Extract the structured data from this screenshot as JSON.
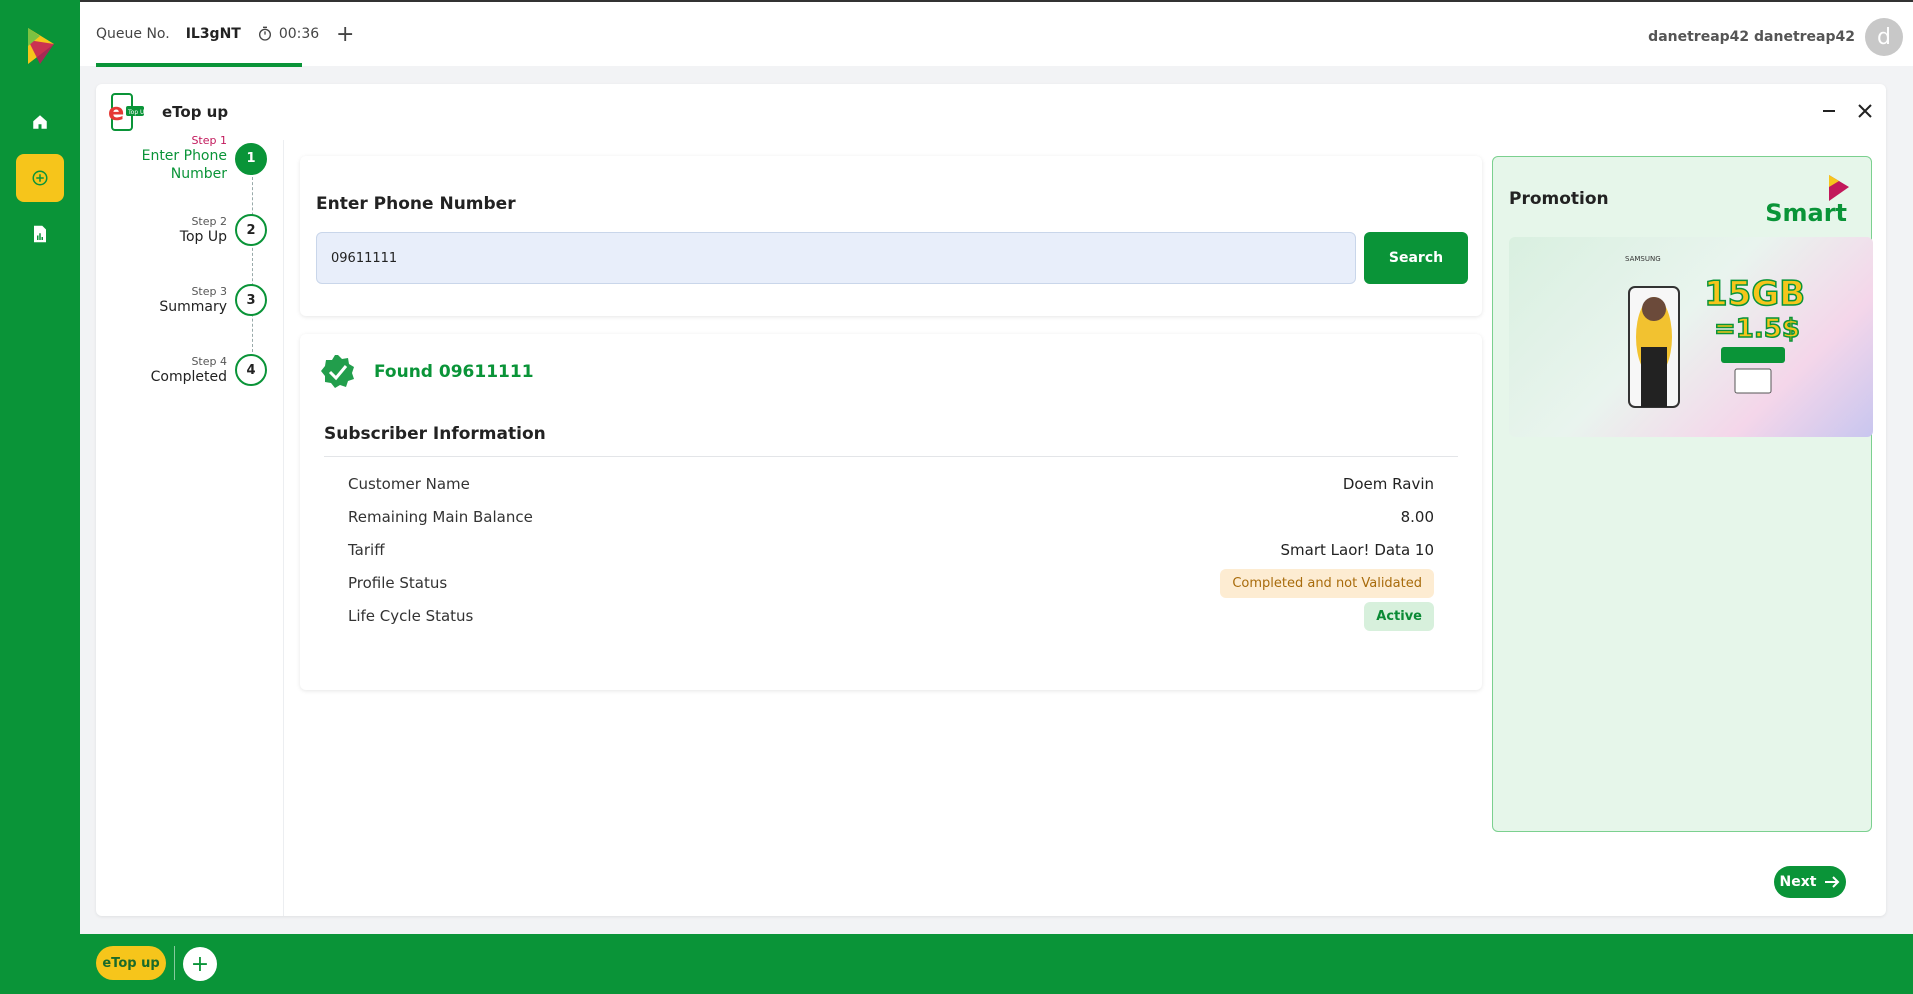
{
  "topbar": {
    "queue_label": "Queue No.",
    "queue_value": "IL3gNT",
    "timer": "00:36",
    "add_tab": "+",
    "username": "danetreap42 danetreap42",
    "avatar_initial": "d"
  },
  "app": {
    "title": "eTop up",
    "logo_badge": "Top Up"
  },
  "steps": [
    {
      "num": "Step 1",
      "name_line1": "Enter Phone",
      "name_line2": "Number",
      "index": "1"
    },
    {
      "num": "Step 2",
      "name_line1": "Top Up",
      "name_line2": "",
      "index": "2"
    },
    {
      "num": "Step 3",
      "name_line1": "Summary",
      "name_line2": "",
      "index": "3"
    },
    {
      "num": "Step 4",
      "name_line1": "Completed",
      "name_line2": "",
      "index": "4"
    }
  ],
  "phone": {
    "heading": "Enter Phone Number",
    "value": "09611111",
    "search_label": "Search"
  },
  "result": {
    "found_text": "Found 09611111",
    "subscriber_title": "Subscriber Information",
    "rows": [
      {
        "label": "Customer Name",
        "value": "Doem Ravin"
      },
      {
        "label": "Remaining Main Balance",
        "value": "8.00"
      },
      {
        "label": "Tariff",
        "value": "Smart Laor! Data 10"
      },
      {
        "label": "Profile Status",
        "value": "Completed and not Validated"
      },
      {
        "label": "Life Cycle Status",
        "value": "Active"
      }
    ]
  },
  "promotion": {
    "title": "Promotion",
    "brand": "Smart",
    "banner_text": {
      "samsung": "SAMSUNG",
      "headline": "15GB",
      "price": "=1.5$"
    }
  },
  "footer": {
    "next_label": "Next",
    "task_tab": "eTop up",
    "task_add": "+"
  },
  "colors": {
    "primary_green": "#0a9438",
    "accent_yellow": "#f6c51b",
    "step_active_pink": "#c2185b",
    "badge_warn_bg": "#fdecd2",
    "badge_ok_bg": "#d7f0dc"
  },
  "icons": {
    "rail": [
      "brand-logo-icon",
      "home-icon",
      "add-circle-icon",
      "report-icon",
      "gear-icon"
    ],
    "topbar": [
      "timer-icon",
      "plus-icon"
    ],
    "window": [
      "minimize-icon",
      "close-icon"
    ],
    "result": [
      "verified-check-icon"
    ],
    "next": "arrow-right-icon"
  }
}
